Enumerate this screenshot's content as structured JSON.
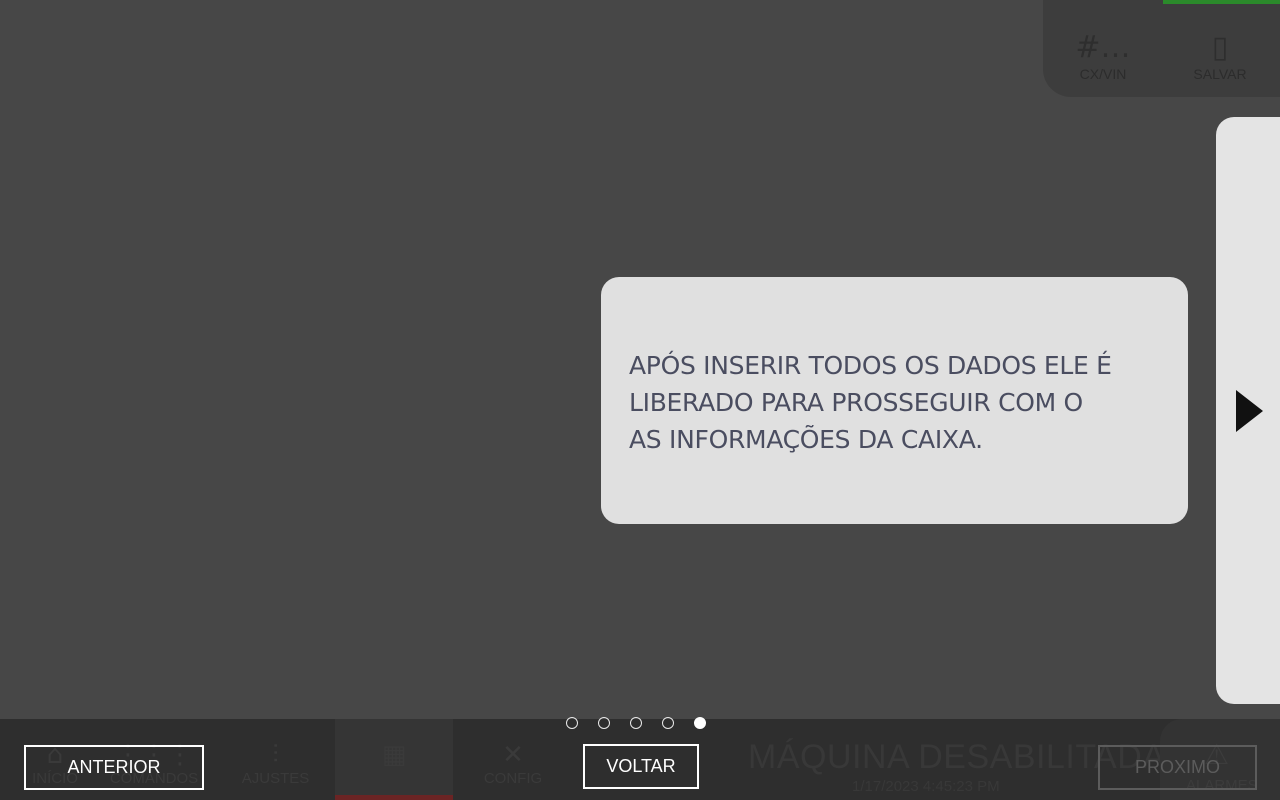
{
  "app": {
    "top_panel": {
      "items": [
        {
          "icon": "hash-icon",
          "glyph": "#…",
          "label": "CX/VIN"
        },
        {
          "icon": "sd-card-icon",
          "glyph": "▯",
          "label": "SALVAR"
        }
      ]
    },
    "bottom_nav": {
      "items": [
        {
          "icon": "home-icon",
          "glyph": "⌂",
          "label": "INÍCIO"
        },
        {
          "icon": "grid-icon",
          "glyph": "⋮⋮⋮",
          "label": "COMANDOS"
        },
        {
          "icon": "sliders-icon",
          "glyph": "⫶",
          "label": "AJUSTES"
        },
        {
          "icon": "box-icon",
          "glyph": "▦",
          "label": ""
        },
        {
          "icon": "tools-icon",
          "glyph": "✕",
          "label": "CONFIG"
        }
      ]
    },
    "status": {
      "title": "MÁQUINA DESABILITADA",
      "datetime": "1/17/2023 4:45:23 PM"
    },
    "alarm": {
      "icon": "warning-icon",
      "glyph": "⚠",
      "label": "ALARMES"
    }
  },
  "tutorial": {
    "message": "APÓS INSERIR TODOS OS DADOS ELE É\nLIBERADO PARA PROSSEGUIR COM O\nAS INFORMAÇÕES DA CAIXA.",
    "steps_total": 5,
    "current_step": 5,
    "buttons": {
      "previous": "ANTERIOR",
      "back": "VOLTAR",
      "next": "PROXIMO"
    }
  },
  "colors": {
    "overlay_bg": "#474747",
    "card_bg": "#e0e0e0",
    "card_text": "#4a4d60",
    "active_nav_accent": "#6b2424",
    "status_green": "#2b8a2b"
  }
}
